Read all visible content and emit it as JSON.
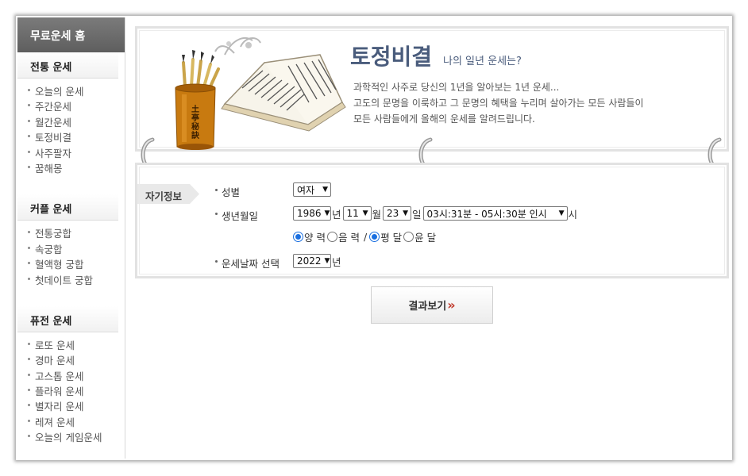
{
  "sidebar": {
    "home_label": "무료운세 홈",
    "groups": [
      {
        "title": "전통 운세",
        "items": [
          "오늘의 운세",
          "주간운세",
          "월간운세",
          "토정비결",
          "사주팔자",
          "꿈해몽"
        ]
      },
      {
        "title": "커플 운세",
        "items": [
          "전통궁합",
          "속궁합",
          "혈액형 궁합",
          "첫데이트 궁합"
        ]
      },
      {
        "title": "퓨전 운세",
        "items": [
          "로또 운세",
          "경마 운세",
          "고스톱 운세",
          "플라워 운세",
          "별자리 운세",
          "레져 운세",
          "오늘의 게임운세"
        ]
      }
    ]
  },
  "banner": {
    "title": "토정비결",
    "subtitle": "나의 일년 운세는?",
    "desc": [
      "과학적인 사주로 당신의 1년을 알아보는 1년 운세...",
      "고도의 문명을 이룩하고 그 문명의 혜택을 누리며 살아가는 모든 사람들이",
      "모든 사람들에게 올해의 운세를 알려드립니다."
    ],
    "cup_text": "土亭秘訣"
  },
  "form": {
    "tab_label": "자기정보",
    "gender": {
      "label": "성별",
      "value": "여자"
    },
    "birth": {
      "label": "생년월일",
      "year": "1986",
      "year_unit": "년",
      "month": "11",
      "month_unit": "월",
      "day": "23",
      "day_unit": "일",
      "time": "03시:31분 - 05시:30분 인시",
      "time_unit": "시"
    },
    "calendar": {
      "solar": "양 력",
      "lunar": "음 력",
      "separator": "/",
      "normal": "평 달",
      "leap": "윤 달",
      "solar_checked": true,
      "lunar_checked": false,
      "normal_checked": true,
      "leap_checked": false
    },
    "fortune_date": {
      "label": "운세날짜 선택",
      "year": "2022",
      "unit": "년"
    }
  },
  "result_button": {
    "label": "결과보기",
    "arrows": "»"
  },
  "colors": {
    "title": "#4a5c7c",
    "accent_arrow": "#c0392b",
    "radio": "#1a6fe0"
  }
}
